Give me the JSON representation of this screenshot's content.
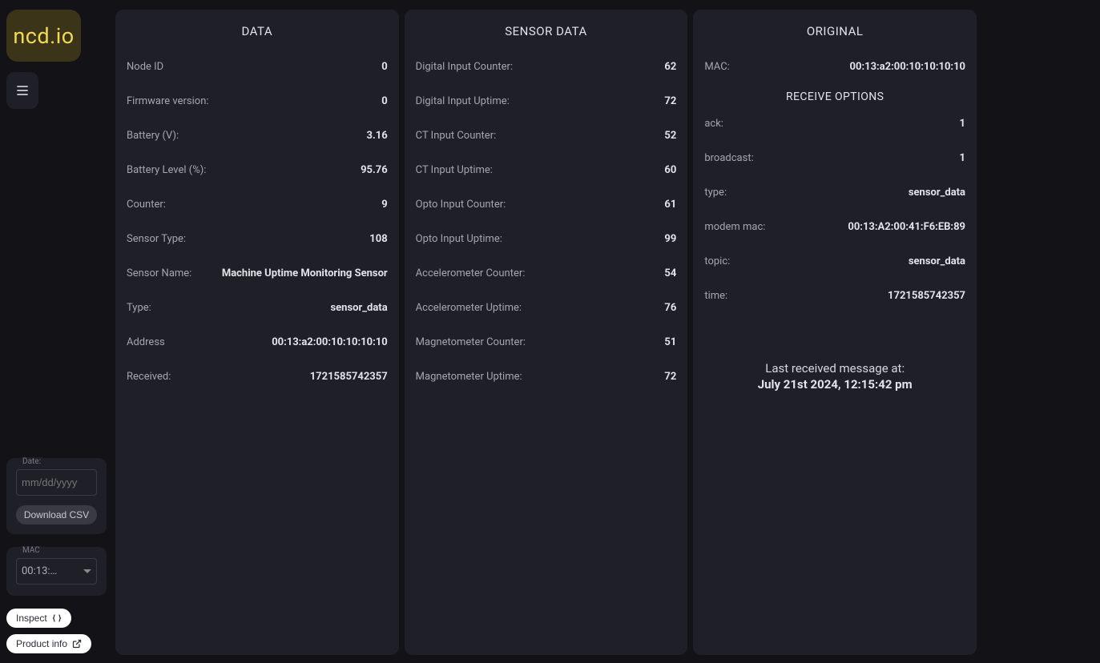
{
  "logo": "ncd.io",
  "sidebar": {
    "date_label": "Date:",
    "date_placeholder": "mm/dd/yyyy",
    "download_label": "Download CSV",
    "mac_label": "MAC",
    "mac_value": "00:13:…",
    "inspect_label": "Inspect",
    "product_info_label": "Product info"
  },
  "panels": {
    "data": {
      "title": "DATA",
      "rows": [
        {
          "label": "Node ID",
          "value": "0"
        },
        {
          "label": "Firmware version:",
          "value": "0"
        },
        {
          "label": "Battery (V):",
          "value": "3.16"
        },
        {
          "label": "Battery Level (%):",
          "value": "95.76"
        },
        {
          "label": "Counter:",
          "value": "9"
        },
        {
          "label": "Sensor Type:",
          "value": "108"
        },
        {
          "label": "Sensor Name:",
          "value": "Machine Uptime Monitoring Sensor"
        },
        {
          "label": "Type:",
          "value": "sensor_data"
        },
        {
          "label": "Address",
          "value": "00:13:a2:00:10:10:10:10"
        },
        {
          "label": "Received:",
          "value": "1721585742357"
        }
      ]
    },
    "sensor": {
      "title": "SENSOR DATA",
      "rows": [
        {
          "label": "Digital Input Counter:",
          "value": "62"
        },
        {
          "label": "Digital Input Uptime:",
          "value": "72"
        },
        {
          "label": "CT Input Counter:",
          "value": "52"
        },
        {
          "label": "CT Input Uptime:",
          "value": "60"
        },
        {
          "label": "Opto Input Counter:",
          "value": "61"
        },
        {
          "label": "Opto Input Uptime:",
          "value": "99"
        },
        {
          "label": "Accelerometer Counter:",
          "value": "54"
        },
        {
          "label": "Accelerometer Uptime:",
          "value": "76"
        },
        {
          "label": "Magnetometer Counter:",
          "value": "51"
        },
        {
          "label": "Magnetometer Uptime:",
          "value": "72"
        }
      ]
    },
    "original": {
      "title": "ORIGINAL",
      "top_rows": [
        {
          "label": "MAC:",
          "value": "00:13:a2:00:10:10:10:10"
        }
      ],
      "receive_title": "RECEIVE OPTIONS",
      "receive_rows": [
        {
          "label": "ack:",
          "value": "1"
        },
        {
          "label": "broadcast:",
          "value": "1"
        },
        {
          "label": "type:",
          "value": "sensor_data"
        },
        {
          "label": "modem mac:",
          "value": "00:13:A2:00:41:F6:EB:89"
        },
        {
          "label": "topic:",
          "value": "sensor_data"
        },
        {
          "label": "time:",
          "value": "1721585742357"
        }
      ],
      "last_msg_label": "Last received message at:",
      "last_msg_value": "July 21st 2024, 12:15:42 pm"
    }
  }
}
